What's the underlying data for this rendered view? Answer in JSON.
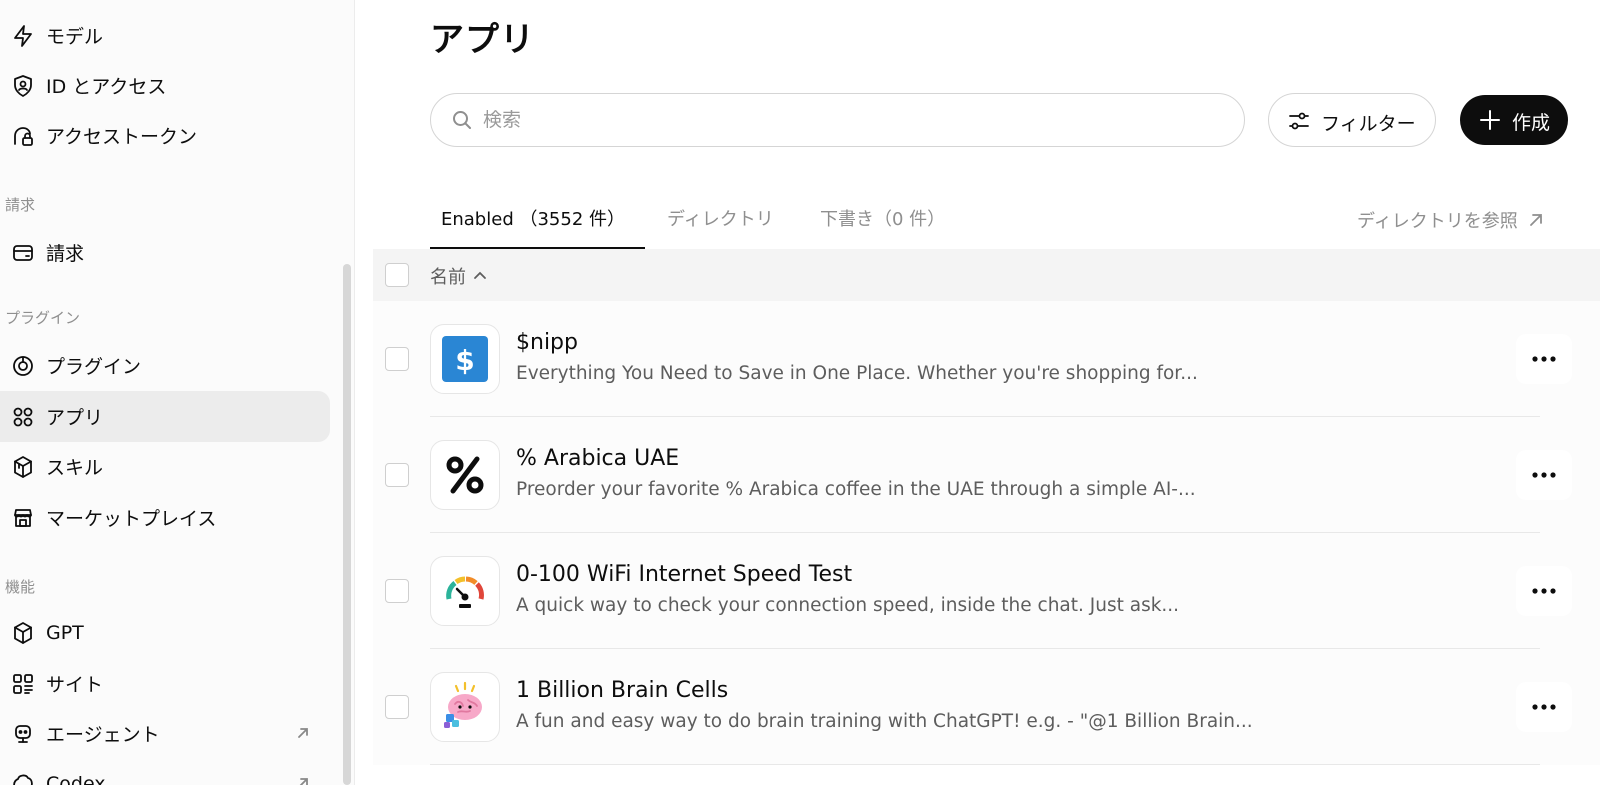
{
  "sidebar": {
    "items_top": [
      {
        "label": "モデル",
        "icon": "bolt-icon"
      },
      {
        "label": "ID とアクセス",
        "icon": "user-shield-icon"
      },
      {
        "label": "アクセストークン",
        "icon": "token-lock-icon"
      }
    ],
    "section_billing": "請求",
    "billing_item": {
      "label": "請求",
      "icon": "card-icon"
    },
    "section_plugins": "プラグイン",
    "plugin_items": [
      {
        "label": "プラグイン",
        "icon": "plugin-icon"
      },
      {
        "label": "アプリ",
        "icon": "apps-icon",
        "active": true
      },
      {
        "label": "スキル",
        "icon": "cube-stack-icon"
      },
      {
        "label": "マーケットプレイス",
        "icon": "store-icon"
      }
    ],
    "section_features": "機能",
    "feature_items": [
      {
        "label": "GPT",
        "icon": "cube-icon"
      },
      {
        "label": "サイト",
        "icon": "grid-icon"
      },
      {
        "label": "エージェント",
        "icon": "robot-icon",
        "external": true
      },
      {
        "label": "Codex",
        "icon": "codex-icon",
        "external": true
      }
    ]
  },
  "main": {
    "title": "アプリ",
    "search_placeholder": "検索",
    "filter_label": "フィルター",
    "create_label": "作成",
    "tabs": [
      {
        "label": "Enabled （3552 件）",
        "active": true
      },
      {
        "label": "ディレクトリ",
        "active": false
      },
      {
        "label": "下書き（0 件）",
        "active": false
      }
    ],
    "browse_link": "ディレクトリを参照",
    "table_header_name": "名前",
    "rows": [
      {
        "name": "$nipp",
        "description": "Everything You Need to Save in One Place. Whether you're shopping for...",
        "icon": "dollar-icon"
      },
      {
        "name": "% Arabica UAE",
        "description": "Preorder your favorite % Arabica coffee in the UAE through a simple AI-...",
        "icon": "percent-icon"
      },
      {
        "name": "0-100 WiFi Internet Speed Test",
        "description": "A quick way to check your connection speed, inside the chat. Just ask...",
        "icon": "speedometer-icon"
      },
      {
        "name": "1 Billion Brain Cells",
        "description": "A fun and easy way to do brain training with ChatGPT! e.g. - \"@1 Billion Brain...",
        "icon": "brain-icon"
      }
    ]
  },
  "colors": {
    "accent": "#0d0d0d",
    "active_bg": "#ececec",
    "dollar_blue": "#2a86d4"
  }
}
